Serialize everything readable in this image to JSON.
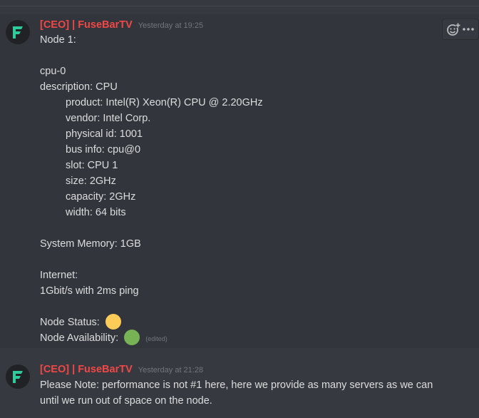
{
  "toolbar": {
    "add_reaction_icon": "emoji-add-icon",
    "more_icon": "more-options-icon"
  },
  "messages": [
    {
      "author": "[CEO] | FuseBarTV",
      "timestamp": "Yesterday at 19:25",
      "lines": {
        "l1": "Node 1:",
        "l2": "cpu-0",
        "l3": "description: CPU",
        "l4": "product: Intel(R) Xeon(R) CPU @ 2.20GHz",
        "l5": "vendor: Intel Corp.",
        "l6": "physical id: 1001",
        "l7": "bus info: cpu@0",
        "l8": "slot: CPU 1",
        "l9": "size: 2GHz",
        "l10": "capacity: 2GHz",
        "l11": "width: 64 bits",
        "l12": "System Memory: 1GB",
        "l13": "Internet:",
        "l14": "1Gbit/s with 2ms ping",
        "l15": "Node Status:",
        "l16": "Node Availability:"
      },
      "status_color": "#fdcb58",
      "availability_color": "#77b255",
      "edited_label": "(edited)"
    },
    {
      "author": "[CEO] | FuseBarTV",
      "timestamp": "Yesterday at 21:28",
      "lines": {
        "l1": "Please Note: performance is not #1 here, here we provide as many servers as we can",
        "l2": "until we run out of space on the node."
      }
    }
  ],
  "colors": {
    "background": "#36393f",
    "hover_background": "#32353b",
    "username": "#f04747",
    "avatar_accent": "#2ecc9a"
  }
}
